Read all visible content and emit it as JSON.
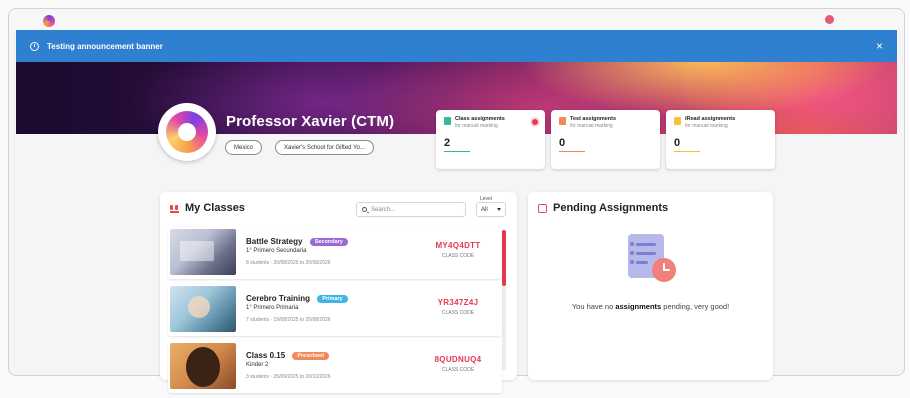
{
  "banner": {
    "text": "Testing announcement banner",
    "close": "×"
  },
  "profile": {
    "name": "Professor Xavier (CTM)",
    "country": "Mexico",
    "school": "Xavier's School for Gifted Yo..."
  },
  "stats": [
    {
      "title": "Class assignments",
      "subtitle": "for manual marking",
      "value": "2",
      "color": "#3bb59a",
      "alert": true
    },
    {
      "title": "Test assignments",
      "subtitle": "for manual marking",
      "value": "0",
      "color": "#f08a5a",
      "alert": false
    },
    {
      "title": "iRead assignments",
      "subtitle": "for manual marking",
      "value": "0",
      "color": "#f5c23a",
      "alert": false
    }
  ],
  "classes_panel": {
    "title": "My Classes",
    "search_placeholder": "Search...",
    "level_label": "Level",
    "level_value": "All",
    "code_label": "CLASS CODE",
    "items": [
      {
        "name": "Battle Strategy",
        "badge": "Secondary",
        "badge_color": "#9b6ad8",
        "grade": "1° Primero Secundaria",
        "meta": "8 students · 20/08/2025 to 20/08/2026",
        "code": "MY4Q4DTT"
      },
      {
        "name": "Cerebro Training",
        "badge": "Primary",
        "badge_color": "#3fb6e8",
        "grade": "1° Primero Primaria",
        "meta": "7 students · 19/08/2025 to 20/08/2026",
        "code": "YR347Z4J"
      },
      {
        "name": "Class 0.15",
        "badge": "Preschool",
        "badge_color": "#f08a5a",
        "grade": "Kinder 2",
        "meta": "3 students · 25/09/2025 to 20/10/2026",
        "code": "8QUDNUQ4"
      }
    ]
  },
  "pending_panel": {
    "title": "Pending Assignments",
    "msg_prefix": "You have no ",
    "msg_bold": "assignments",
    "msg_suffix": " pending, very good!"
  }
}
